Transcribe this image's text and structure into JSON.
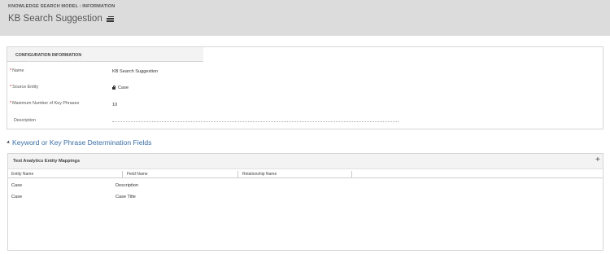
{
  "header": {
    "breadcrumb": "KNOWLEDGE SEARCH MODEL : INFORMATION",
    "title": "KB Search Suggestion",
    "background": "#dcdcdc"
  },
  "config": {
    "section_title": "CONFIGURATION INFORMATION",
    "fields": {
      "name": {
        "label": "Name",
        "required": "*",
        "value": "KB Search Suggestion"
      },
      "source_entity": {
        "label": "Source Entity",
        "required": "*",
        "value": "Case",
        "icon": "lock-icon"
      },
      "max_key_phrases": {
        "label": "Maximum Number of Key Phrases",
        "required": "*",
        "value": "10"
      },
      "description": {
        "label": "Description",
        "value": ""
      }
    }
  },
  "keyword_section": {
    "title": "Keyword or Key Phrase Determination Fields",
    "accent": "#3b6fa6"
  },
  "grid": {
    "title": "Text Analytics Entity Mappings",
    "add_label": "+",
    "columns": [
      "Entity Name",
      "Field Name",
      "Relationship Name"
    ],
    "rows": [
      {
        "entity": "Case",
        "field": "Description",
        "relationship": ""
      },
      {
        "entity": "Case",
        "field": "Case Title",
        "relationship": ""
      }
    ]
  },
  "colors": {
    "required": "#cc0000",
    "link": "#3b6fa6"
  }
}
